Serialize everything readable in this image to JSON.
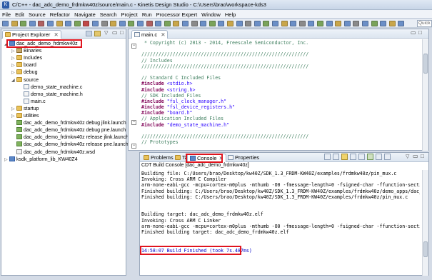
{
  "window": {
    "title": "C/C++ - dac_adc_demo_frdmkw40z/source/main.c - Kinetis Design Studio - C:\\Users\\brao\\workspace-kds3"
  },
  "menu": [
    "File",
    "Edit",
    "Source",
    "Refactor",
    "Navigate",
    "Search",
    "Project",
    "Run",
    "Processor Expert",
    "Window",
    "Help"
  ],
  "toolbar": {
    "quick_access_placeholder": "Quick A"
  },
  "explorer": {
    "tab_label": "Project Explorer",
    "tree": [
      {
        "label": "dac_adc_demo_frdmkw40z",
        "icon": "project-icon",
        "expanded": true
      },
      {
        "label": "Binaries",
        "icon": "binaries-icon"
      },
      {
        "label": "Includes",
        "icon": "includes-icon"
      },
      {
        "label": "board",
        "icon": "folder-icon"
      },
      {
        "label": "debug",
        "icon": "folder-icon"
      },
      {
        "label": "source",
        "icon": "folder-icon",
        "expanded": true
      },
      {
        "label": "demo_state_machine.c",
        "icon": "c-file-icon"
      },
      {
        "label": "demo_state_machine.h",
        "icon": "h-file-icon"
      },
      {
        "label": "main.c",
        "icon": "c-file-icon"
      },
      {
        "label": "startup",
        "icon": "folder-icon"
      },
      {
        "label": "utilities",
        "icon": "folder-icon"
      },
      {
        "label": "dac_adc_demo_frdmkw40z debug jlink.launch",
        "icon": "launch-icon"
      },
      {
        "label": "dac_adc_demo_frdmkw40z debug pne.launch",
        "icon": "launch-icon"
      },
      {
        "label": "dac_adc_demo_frdmkw40z release jlink.launch",
        "icon": "launch-icon"
      },
      {
        "label": "dac_adc_demo_frdmkw40z release pne.launch",
        "icon": "launch-icon"
      },
      {
        "label": "dac_adc_demo_frdmkw40z.wsd",
        "icon": "wsd-file-icon"
      },
      {
        "label": "ksdk_platform_lib_KW40Z4",
        "icon": "project-icon"
      }
    ]
  },
  "editor": {
    "tab_label": "main.c",
    "lines": [
      {
        "t": "cm",
        "v": " * Copyright (c) 2013 - 2014, Freescale Semiconductor, Inc."
      },
      {
        "t": "",
        "v": ""
      },
      {
        "t": "cm",
        "v": "///////////////////////////////////////////////////////////"
      },
      {
        "t": "cm",
        "v": "// Includes"
      },
      {
        "t": "cm",
        "v": "///////////////////////////////////////////////////////////"
      },
      {
        "t": "",
        "v": ""
      },
      {
        "t": "cm",
        "v": "// Standard C Included Files"
      },
      {
        "t": "inc",
        "v": "#include <stdio.h>"
      },
      {
        "t": "inc",
        "v": "#include <string.h>"
      },
      {
        "t": "cm",
        "v": "// SDK Included Files"
      },
      {
        "t": "inc",
        "v": "#include \"fsl_clock_manager.h\""
      },
      {
        "t": "inc",
        "v": "#include \"fsl_device_registers.h\""
      },
      {
        "t": "inc",
        "v": "#include \"board.h\""
      },
      {
        "t": "cm",
        "v": "// Application Included Files"
      },
      {
        "t": "inc",
        "v": "#include \"demo_state_machine.h\""
      },
      {
        "t": "",
        "v": ""
      },
      {
        "t": "cm",
        "v": "///////////////////////////////////////////////////////////"
      },
      {
        "t": "cm",
        "v": "// Prototypes"
      }
    ]
  },
  "console": {
    "tabs": [
      "Problems",
      "Tasks",
      "Console",
      "Properties"
    ],
    "active_tab": "Console",
    "title": "CDT Build Console [dac_adc_demo_frdmkw40z]",
    "lines": [
      "Building file: C:/Users/brao/Desktop/kw40Z/SDK_1.3_FRDM-KW40Z/examples/frdmkw40z/pin_mux.c",
      "Invoking: Cross ARM C Compiler",
      "arm-none-eabi-gcc -mcpu=cortex-m0plus -mthumb -O0 -fmessage-length=0 -fsigned-char -ffunction-sections -fdat",
      "Finished building: C:/Users/brao/Desktop/kw40Z/SDK_1.3_FRDM-KW40Z/examples/frdmkw40z/demo_apps/dac_adc_demo/",
      "Finished building: C:/Users/brao/Desktop/kw40Z/SDK_1.3_FRDM-KW40Z/examples/frdmkw40z/pin_mux.c",
      "",
      "",
      "Building target: dac_adc_demo_frdmkw40z.elf",
      "Invoking: Cross ARM C Linker",
      "arm-none-eabi-gcc -mcpu=cortex-m0plus -mthumb -O0 -fmessage-length=0 -fsigned-char -ffunction-sections -fdat",
      "Finished building target: dac_adc_demo_frdmkw40z.elf",
      "",
      ""
    ],
    "finished_line": "14:58:07 Build Finished (took 7s.487ms)"
  },
  "colors": {
    "highlight": "#e0141e",
    "comment": "#3f7f5f",
    "keyword": "#7f0055",
    "string": "#2a00ff",
    "finished": "#0000c8"
  }
}
